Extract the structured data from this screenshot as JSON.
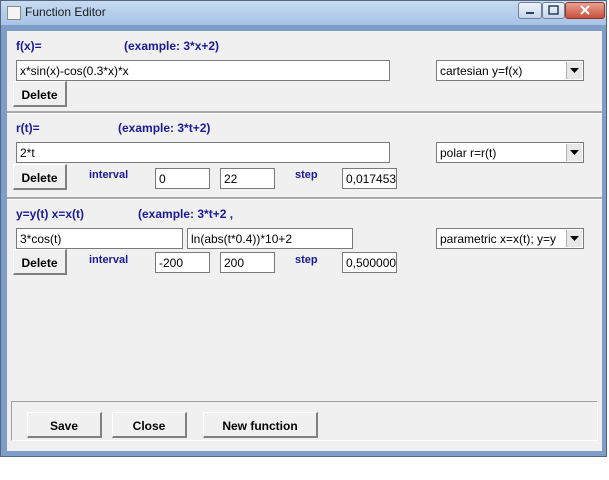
{
  "window": {
    "title": "Function Editor",
    "colors": {
      "frame": "#7f9dc9",
      "label_blue": "#1a1a99"
    }
  },
  "cartesian": {
    "label": "f(x)=",
    "example": "(example: 3*x+2)",
    "expression": "x*sin(x)-cos(0.3*x)*x",
    "type_selected": "cartesian y=f(x)",
    "delete_label": "Delete"
  },
  "polar": {
    "label": "r(t)=",
    "example": "(example: 3*t+2)",
    "expression": "2*t",
    "type_selected": "polar r=r(t)",
    "delete_label": "Delete",
    "interval_label": "interval",
    "interval_from": "0",
    "interval_to": "22",
    "step_label": "step",
    "step_value": "0,017453"
  },
  "parametric": {
    "label": "y=y(t) x=x(t)",
    "example": "(example: 3*t+2 ,",
    "x_expression": "3*cos(t)",
    "y_expression": "ln(abs(t*0.4))*10+2",
    "type_selected": "parametric x=x(t); y=y",
    "delete_label": "Delete",
    "interval_label": "interval",
    "interval_from": "-200",
    "interval_to": "200",
    "step_label": "step",
    "step_value": "0,500000"
  },
  "footer": {
    "save_label": "Save",
    "close_label": "Close",
    "new_function_label": "New function"
  }
}
